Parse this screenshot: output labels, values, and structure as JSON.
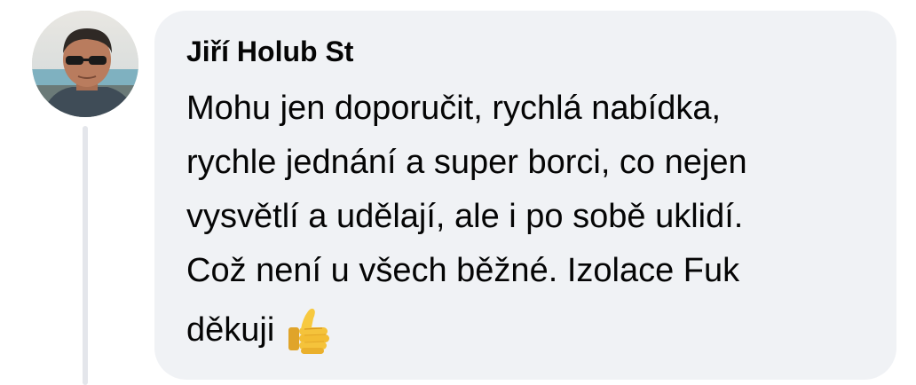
{
  "comment": {
    "author": "Jiří Holub St",
    "lines": [
      "Mohu jen doporučit, rychlá nabídka,",
      "rychle jednání a super borci, co nejen",
      "vysvětlí a udělají, ale i po sobě uklidí.",
      "Což není u všech běžné. Izolace Fuk",
      "děkuji"
    ],
    "emoji": "thumbs-up"
  },
  "colors": {
    "bubble": "#f0f2f5",
    "text": "#050505",
    "thread_line": "#e4e6eb",
    "thumb_yellow": "#f5c33b"
  }
}
